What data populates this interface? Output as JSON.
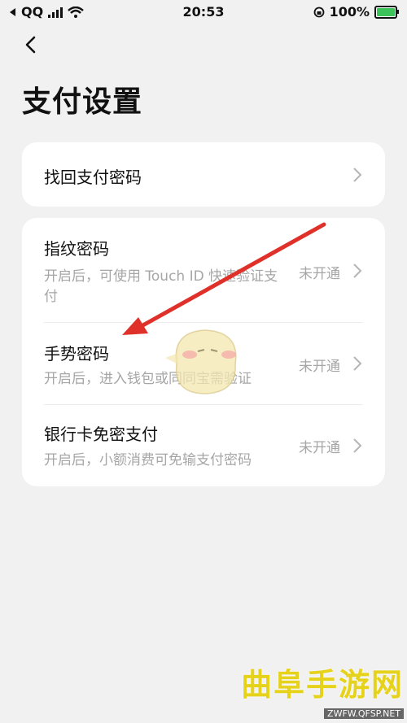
{
  "status_bar": {
    "carrier": "QQ",
    "time": "20:53",
    "battery": "100%"
  },
  "page_title": "支付设置",
  "card1": {
    "item": {
      "title": "找回支付密码"
    }
  },
  "card2": {
    "items": [
      {
        "title": "指纹密码",
        "subtitle": "开启后，可使用 Touch ID 快速验证支付",
        "status": "未开通"
      },
      {
        "title": "手势密码",
        "subtitle": "开启后，进入钱包或同同宝需验证",
        "status": "未开通"
      },
      {
        "title": "银行卡免密支付",
        "subtitle": "开启后，小额消费可免输支付密码",
        "status": "未开通"
      }
    ]
  },
  "watermark": {
    "main": "曲阜手游网",
    "sub": "ZWFW.QFSP.NET"
  },
  "colors": {
    "arrow": "#e0302a",
    "subtext": "#a6a6a6",
    "battery": "#3cc45a",
    "watermark": "#e6d21a"
  }
}
